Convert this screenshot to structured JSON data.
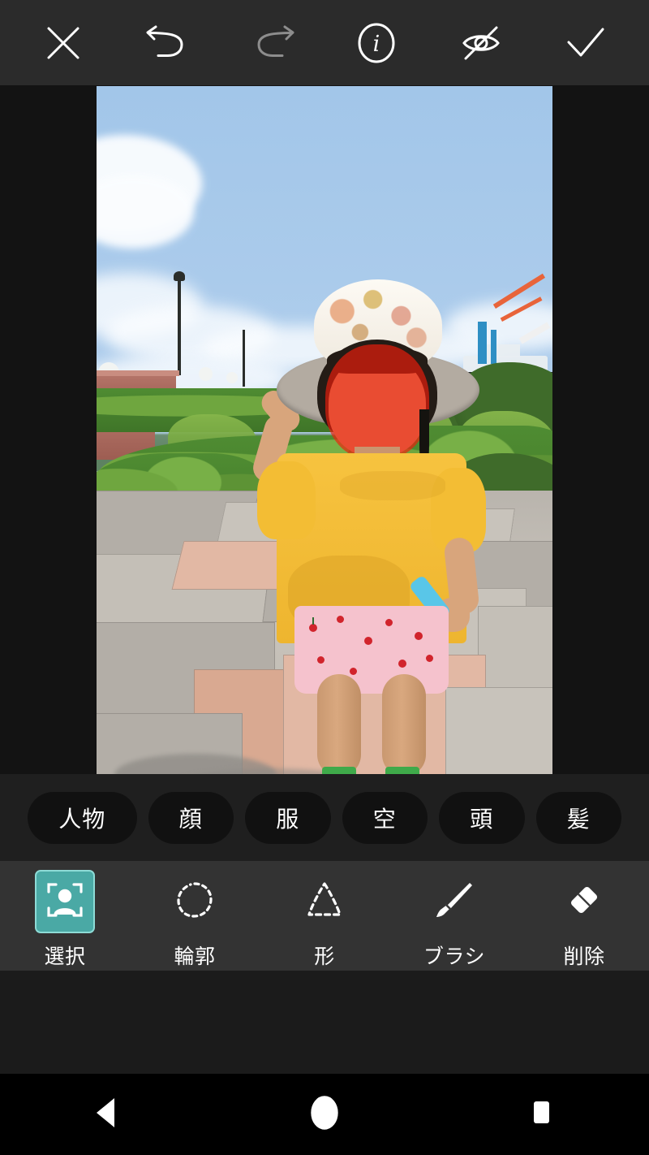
{
  "app": {
    "theme_bg": "#1b1b1b",
    "toolbar_bg": "#2b2b2b",
    "accent": "#4aa9a5",
    "accent_border": "#8ddbd6",
    "mask_color": "#f21d0a"
  },
  "toolbar": {
    "close": {
      "name": "close",
      "icon": "close-icon",
      "state": "enabled"
    },
    "undo": {
      "name": "undo",
      "icon": "undo-icon",
      "state": "enabled"
    },
    "redo": {
      "name": "redo",
      "icon": "redo-icon",
      "state": "disabled"
    },
    "info": {
      "name": "info",
      "icon": "info-icon",
      "state": "enabled"
    },
    "hide": {
      "name": "hide-mask",
      "icon": "eye-off-icon",
      "state": "enabled"
    },
    "confirm": {
      "name": "confirm",
      "icon": "check-icon",
      "state": "enabled"
    }
  },
  "chips": [
    {
      "label": "人物",
      "selected": false
    },
    {
      "label": "顔",
      "selected": false
    },
    {
      "label": "服",
      "selected": false
    },
    {
      "label": "空",
      "selected": false
    },
    {
      "label": "頭",
      "selected": false
    },
    {
      "label": "髪",
      "selected": false
    }
  ],
  "tools": [
    {
      "label": "選択",
      "icon": "person-select-icon",
      "selected": true
    },
    {
      "label": "輪郭",
      "icon": "lasso-icon",
      "selected": false
    },
    {
      "label": "形",
      "icon": "shape-icon",
      "selected": false
    },
    {
      "label": "ブラシ",
      "icon": "brush-icon",
      "selected": false
    },
    {
      "label": "削除",
      "icon": "eraser-icon",
      "selected": false
    }
  ],
  "canvas": {
    "description": "写真: 帽子をかぶった子どもが遊歩道に立っている",
    "selection_overlay": "顔に赤いマスク"
  },
  "navbar": [
    {
      "label": "戻る",
      "icon": "back-triangle-icon"
    },
    {
      "label": "ホーム",
      "icon": "home-circle-icon"
    },
    {
      "label": "履歴",
      "icon": "recents-square-icon"
    }
  ]
}
